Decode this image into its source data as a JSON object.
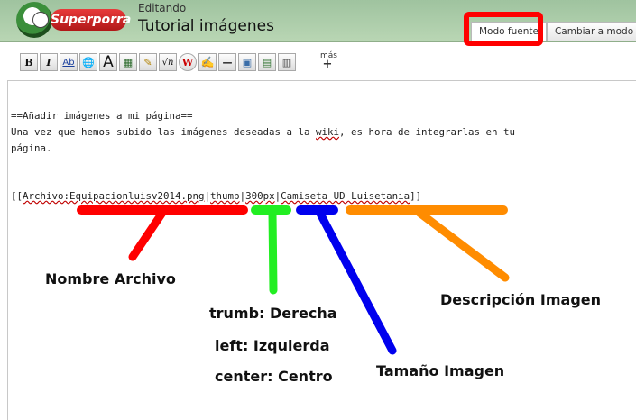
{
  "header": {
    "logo_text": "Superporra",
    "edit_status": "Editando",
    "page_title": "Tutorial imágenes",
    "tabs": [
      {
        "label": "Modo fuente",
        "active": true
      },
      {
        "label": "Cambiar a modo vis",
        "active": false
      }
    ]
  },
  "toolbar": {
    "buttons": [
      {
        "name": "bold-button",
        "label": "B"
      },
      {
        "name": "italic-button",
        "label": "I"
      },
      {
        "name": "link-button",
        "label": "Ab"
      },
      {
        "name": "external-link-button",
        "label": "🌐"
      },
      {
        "name": "heading-button",
        "label": "A"
      },
      {
        "name": "image-button",
        "label": "▦"
      },
      {
        "name": "media-button",
        "label": "✎"
      },
      {
        "name": "math-button",
        "label": "√n"
      },
      {
        "name": "nowiki-button",
        "label": "W"
      },
      {
        "name": "signature-button",
        "label": "✍"
      },
      {
        "name": "horizontal-line-button",
        "label": "—"
      },
      {
        "name": "gallery-button",
        "label": "▣"
      },
      {
        "name": "template-button",
        "label": "▤"
      },
      {
        "name": "table-button",
        "label": "▥"
      }
    ],
    "more_label": "más",
    "more_plus": "+"
  },
  "editor": {
    "line1": "==Añadir imágenes a mi página==",
    "line2_before": "Una vez que hemos subido las imágenes deseadas a la ",
    "line2_link": "wiki",
    "line2_after": ", es hora de integrarlas en tu",
    "line3": "página.",
    "code_open": "[[",
    "code_file": "Archivo:Equipacionluisv2014.png",
    "sep": "|",
    "code_thumb": "thumb",
    "code_size": "300px",
    "code_caption": "Camiseta UD Luisetania",
    "code_close": "]]"
  },
  "annotations": {
    "file_name": "Nombre Archivo",
    "thumb_right": "trumb: Derecha",
    "left": "left: Izquierda",
    "center": "center: Centro",
    "size": "Tamaño Imagen",
    "description": "Descripción Imagen"
  },
  "colors": {
    "header_bg": "#b3d3ad",
    "highlight_box": "#ff0000",
    "file_marker": "#ff0000",
    "thumb_marker": "#22ee22",
    "size_marker": "#0000ee",
    "caption_marker": "#ff8c00"
  }
}
